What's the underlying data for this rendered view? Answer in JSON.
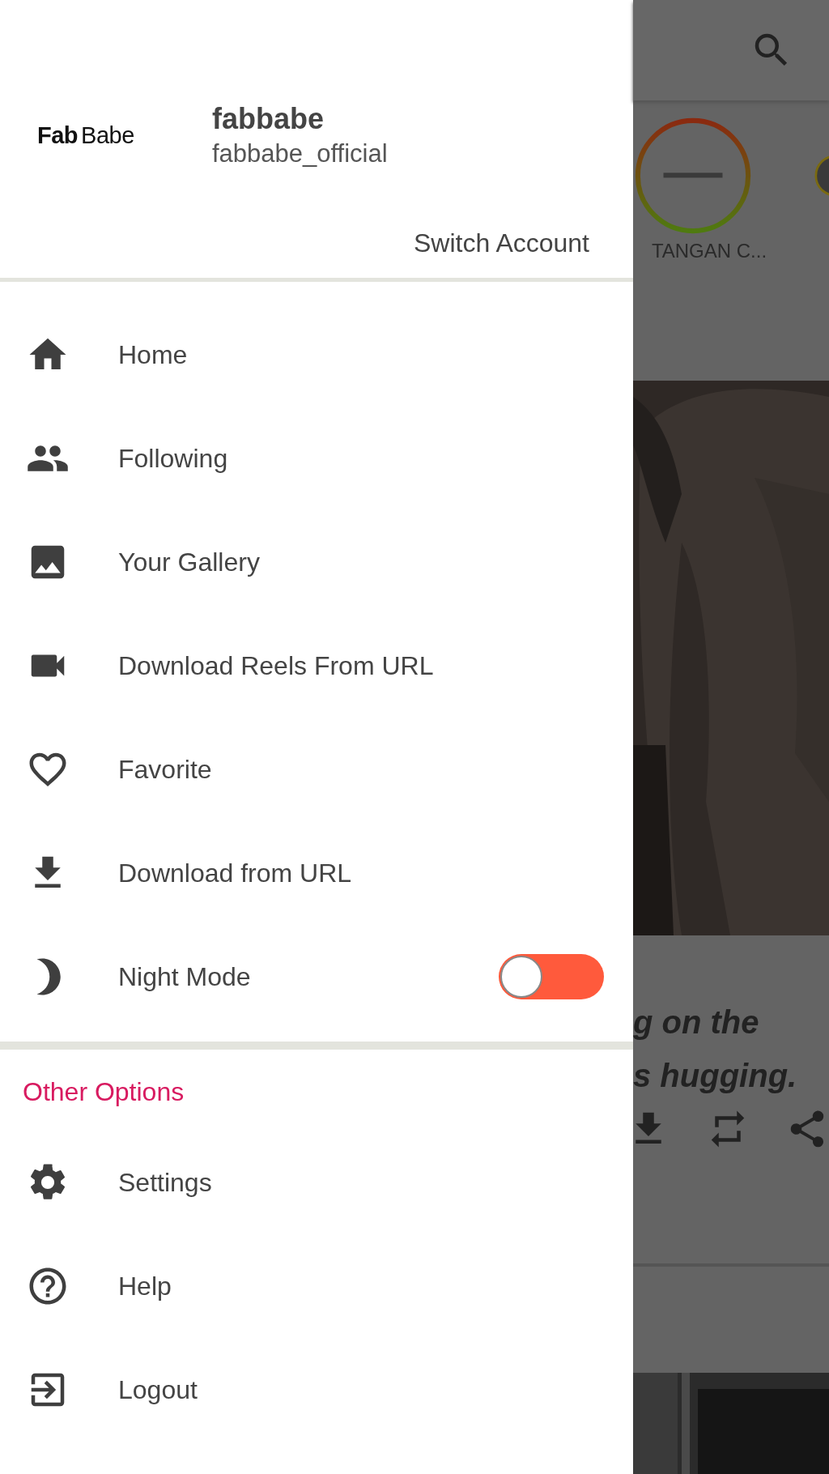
{
  "drawer": {
    "logo": {
      "part_1": "Fab",
      "part_2": "Babe"
    },
    "name": "fabbabe",
    "handle": "fabbabe_official",
    "switch_account": "Switch Account",
    "items": [
      {
        "kind": "link",
        "label": "Home"
      },
      {
        "kind": "link",
        "label": "Following"
      },
      {
        "kind": "link",
        "label": "Your Gallery"
      },
      {
        "kind": "link",
        "label": "Download Reels From URL"
      },
      {
        "kind": "link",
        "label": "Favorite"
      },
      {
        "kind": "link",
        "label": "Download from URL"
      },
      {
        "kind": "toggle",
        "label": "Night Mode",
        "on": false
      }
    ],
    "section_title": "Other Options",
    "other_items": [
      {
        "label": "Settings"
      },
      {
        "label": "Help"
      },
      {
        "label": "Logout"
      }
    ]
  },
  "background": {
    "story_label": "TANGAN C...",
    "caption_lines": [
      "g on the",
      "s hugging."
    ]
  }
}
